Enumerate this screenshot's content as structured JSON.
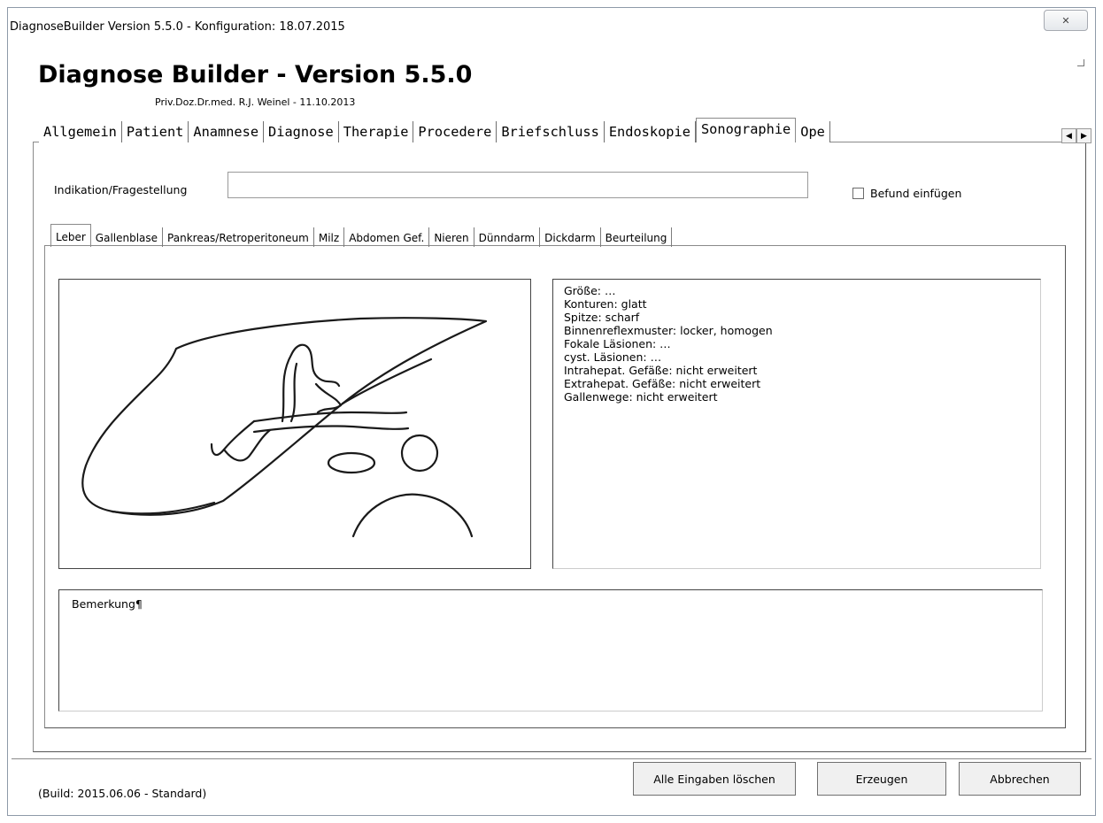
{
  "window": {
    "title": "DiagnoseBuilder Version 5.5.0 - Konfiguration: 18.07.2015",
    "close_glyph": "✕"
  },
  "header": {
    "app_title": "Diagnose Builder - Version 5.5.0",
    "subtitle": "Priv.Doz.Dr.med. R.J. Weinel - 11.10.2013"
  },
  "main_tabs": [
    {
      "label": "Allgemein",
      "active": false
    },
    {
      "label": "Patient",
      "active": false
    },
    {
      "label": "Anamnese",
      "active": false
    },
    {
      "label": "Diagnose",
      "active": false
    },
    {
      "label": "Therapie",
      "active": false
    },
    {
      "label": "Procedere",
      "active": false
    },
    {
      "label": "Briefschluss",
      "active": false
    },
    {
      "label": "Endoskopie",
      "active": false
    },
    {
      "label": "Sonographie",
      "active": true
    },
    {
      "label": "Ope",
      "active": false
    }
  ],
  "tab_scroll": {
    "left_glyph": "◀",
    "right_glyph": "▶"
  },
  "indication": {
    "label": "Indikation/Fragestellung",
    "value": ""
  },
  "befund_checkbox": {
    "label": "Befund einfügen",
    "checked": false
  },
  "sub_tabs": [
    {
      "label": "Leber",
      "active": true
    },
    {
      "label": "Gallenblase",
      "active": false
    },
    {
      "label": "Pankreas/Retroperitoneum",
      "active": false
    },
    {
      "label": "Milz",
      "active": false
    },
    {
      "label": "Abdomen Gef.",
      "active": false
    },
    {
      "label": "Nieren",
      "active": false
    },
    {
      "label": "Dünndarm",
      "active": false
    },
    {
      "label": "Dickdarm",
      "active": false
    },
    {
      "label": "Beurteilung",
      "active": false
    }
  ],
  "findings": [
    "Größe: …",
    "Konturen: glatt",
    "Spitze: scharf",
    "Binnenreflexmuster: locker, homogen",
    "Fokale Läsionen: …",
    "cyst. Läsionen: …",
    "Intrahepat. Gefäße: nicht erweitert",
    "Extrahepat. Gefäße: nicht erweitert",
    "Gallenwege: nicht erweitert"
  ],
  "remark": {
    "text": "Bemerkung¶"
  },
  "footer": {
    "build": "(Build: 2015.06.06 - Standard)",
    "clear_label": "Alle Eingaben löschen",
    "generate_label": "Erzeugen",
    "cancel_label": "Abbrechen"
  }
}
